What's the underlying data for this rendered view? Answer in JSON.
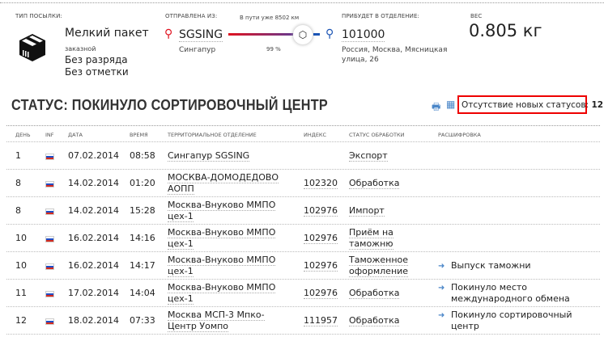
{
  "parcel": {
    "type_label": "Тип посылки:",
    "type": "Мелкий пакет",
    "kind": "заказной",
    "rank": "Без разряда",
    "mark": "Без отметки"
  },
  "route": {
    "from_label": "Отправлена из:",
    "from_code": "SGSING",
    "from_city": "Сингапур",
    "transit": "В пути уже 8502 км",
    "progress_text": "99 %",
    "progress": 0.99,
    "to_label": "Прибудет в отделение:",
    "to_code": "101000",
    "to_address": "Россия, Москва, Мясницкая улица, 26"
  },
  "weight": {
    "label": "Вес",
    "value": "0.805 кг"
  },
  "status": {
    "title": "СТАТУС: ПОКИНУЛО СОРТИРОВОЧНЫЙ ЦЕНТР",
    "no_new_label": "Отсутствие новых статусов:",
    "no_new_count": "12"
  },
  "table": {
    "headers": [
      "День",
      "INF",
      "Дата",
      "Время",
      "Территориальное отделение",
      "Индекс",
      "Статус обработки",
      "Расшифровка"
    ],
    "rows": [
      {
        "day": "1",
        "date": "07.02.2014",
        "time": "08:58",
        "office": "Сингапур SGSING",
        "index": "",
        "status": "Экспорт",
        "decode": ""
      },
      {
        "day": "8",
        "date": "14.02.2014",
        "time": "01:20",
        "office": "МОСКВА-ДОМОДЕДОВО АОПП",
        "index": "102320",
        "status": "Обработка",
        "decode": ""
      },
      {
        "day": "8",
        "date": "14.02.2014",
        "time": "15:28",
        "office": "Москва-Внуково ММПО цех-1",
        "index": "102976",
        "status": "Импорт",
        "decode": ""
      },
      {
        "day": "10",
        "date": "16.02.2014",
        "time": "14:16",
        "office": "Москва-Внуково ММПО цех-1",
        "index": "102976",
        "status": "Приём на таможню",
        "decode": ""
      },
      {
        "day": "10",
        "date": "16.02.2014",
        "time": "14:17",
        "office": "Москва-Внуково ММПО цех-1",
        "index": "102976",
        "status": "Таможенное оформление",
        "decode": "Выпуск таможни"
      },
      {
        "day": "11",
        "date": "17.02.2014",
        "time": "14:04",
        "office": "Москва-Внуково ММПО цех-1",
        "index": "102976",
        "status": "Обработка",
        "decode": "Покинуло место международного обмена"
      },
      {
        "day": "12",
        "date": "18.02.2014",
        "time": "07:33",
        "office": "Москва МСП-3 Мпко-Центр Уомпо",
        "index": "111957",
        "status": "Обработка",
        "decode": "Покинуло сортировочный центр"
      }
    ]
  }
}
